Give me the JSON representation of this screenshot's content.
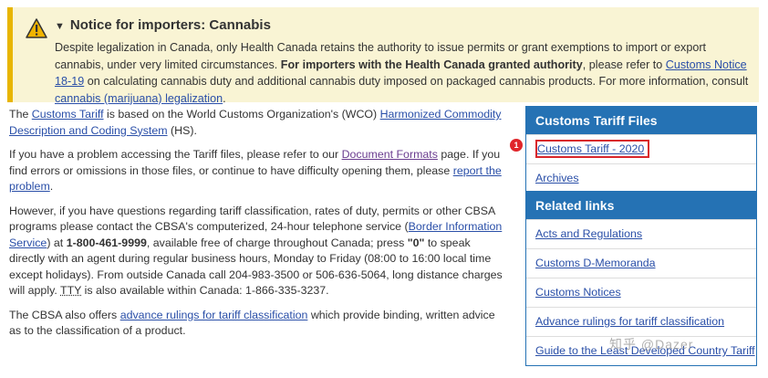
{
  "notice": {
    "title": "Notice for importers: Cannabis",
    "text1": "Despite legalization in Canada, only Health Canada retains the authority to issue permits or grant exemptions to import or export cannabis, under very limited circumstances. ",
    "bold": "For importers with the Health Canada granted authority",
    "text2": ", please refer to ",
    "link1": "Customs Notice 18-19",
    "text3": " on calculating cannabis duty and additional cannabis duty imposed on packaged cannabis products. For more information, consult ",
    "link2": "cannabis (marijuana) legalization",
    "text4": "."
  },
  "main": {
    "p1": {
      "t1": "The ",
      "l1": "Customs Tariff",
      "t2": " is based on the World Customs Organization's (WCO) ",
      "l2": "Harmonized Commodity Description and Coding System",
      "t3": " (HS)."
    },
    "p2": {
      "t1": "If you have a problem accessing the Tariff files, please refer to our ",
      "l1": "Document Formats",
      "t2": " page. If you find errors or omissions in those files, or continue to have difficulty opening them, please ",
      "l2": "report the problem",
      "t3": "."
    },
    "p3": {
      "t1": "However, if you have questions regarding tariff classification, rates of duty, permits or other CBSA programs please contact the CBSA's computerized, 24-hour telephone service (",
      "l1": "Border Information Service",
      "t2": ") at ",
      "b1": "1-800-461-9999",
      "t3": ", available free of charge throughout Canada; press ",
      "b2": "\"0\"",
      "t4": " to speak directly with an agent during regular business hours, Monday to Friday (08:00 to 16:00 local time except holidays). From outside Canada call 204-983-3500 or 506-636-5064, long distance charges will apply. ",
      "abbr": "TTY",
      "t5": " is also available within Canada: 1-866-335-3237."
    },
    "p4": {
      "t1": "The CBSA also offers ",
      "l1": "advance rulings for tariff classification",
      "t2": " which provide binding, written advice as to the classification of a product."
    }
  },
  "sidebar": {
    "files_heading": "Customs Tariff Files",
    "files": [
      "Customs Tariff - 2020",
      "Archives"
    ],
    "related_heading": "Related links",
    "related": [
      "Acts and Regulations",
      "Customs D-Memoranda",
      "Customs Notices",
      "Advance rulings for tariff classification",
      "Guide to the Least Developed Country Tariff"
    ]
  },
  "annotation_badge": "1",
  "watermark": "知乎 @Dazer",
  "colors": {
    "accent": "#2572b4",
    "notice_bg": "#f9f4d4",
    "notice_border": "#e8b500",
    "highlight": "#d9262b"
  }
}
